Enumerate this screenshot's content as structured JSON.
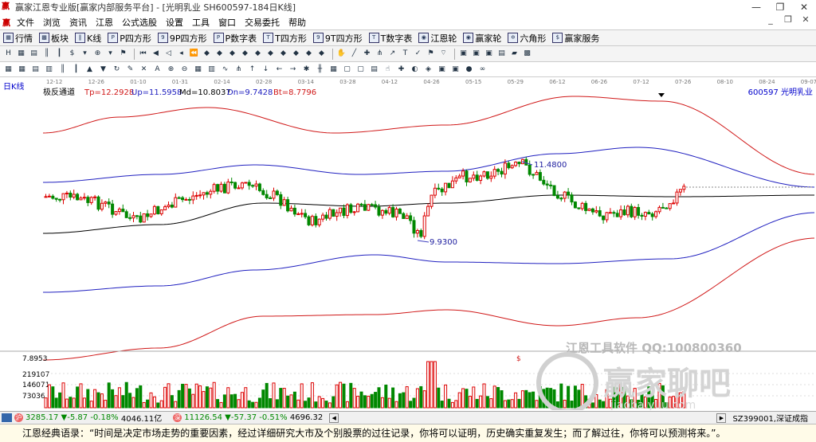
{
  "window": {
    "title": "赢家江恩专业版[赢家内部服务平台] - [光明乳业  SH600597-184日K线]",
    "minimize": "—",
    "restore": "❐",
    "close": "✕"
  },
  "menu": {
    "items": [
      "文件",
      "浏览",
      "资讯",
      "江恩",
      "公式选股",
      "设置",
      "工具",
      "窗口",
      "交易委托",
      "帮助"
    ],
    "mdi_minimize": "_",
    "mdi_restore": "❐",
    "mdi_close": "✕"
  },
  "toolbar": {
    "items": [
      {
        "icon": "table-icon",
        "glyph": "▦",
        "label": "行情"
      },
      {
        "icon": "sector-icon",
        "glyph": "▩",
        "label": "板块"
      },
      {
        "icon": "candle-icon",
        "glyph": "‖",
        "label": "K线"
      },
      {
        "icon": "p-square-icon",
        "glyph": "P",
        "label": "P四方形"
      },
      {
        "icon": "9p-square-icon",
        "glyph": "9",
        "label": "9P四方形"
      },
      {
        "icon": "p-table-icon",
        "glyph": "P",
        "label": "P数字表"
      },
      {
        "icon": "t-square-icon",
        "glyph": "T",
        "label": "T四方形"
      },
      {
        "icon": "9t-square-icon",
        "glyph": "9",
        "label": "9T四方形"
      },
      {
        "icon": "t-table-icon",
        "glyph": "T",
        "label": "T数字表"
      },
      {
        "icon": "gann-wheel-icon",
        "glyph": "◉",
        "label": "江恩轮"
      },
      {
        "icon": "winner-wheel-icon",
        "glyph": "◉",
        "label": "赢家轮"
      },
      {
        "icon": "hexagon-icon",
        "glyph": "✡",
        "label": "六角形"
      },
      {
        "icon": "service-icon",
        "glyph": "$",
        "label": "赢家服务"
      }
    ]
  },
  "chart_header": {
    "period": "日K线",
    "indicator": "极反通道",
    "tp": "Tp=12.2928",
    "up": "Up=11.5958",
    "md": "Md=10.8037",
    "dn": "Dn=9.7428",
    "bt": "Bt=8.7796",
    "stock": "600597  光明乳业"
  },
  "date_labels": [
    "12-12",
    "12-26",
    "01-10",
    "01-31",
    "02-14",
    "02-28",
    "03-14",
    "03-28",
    "04-12",
    "04-26",
    "05-15",
    "05-29",
    "06-12",
    "06-26",
    "07-12",
    "07-26",
    "08-10",
    "08-24",
    "09-07"
  ],
  "annotations": {
    "high": "11.4800",
    "low": "9.9300",
    "dollar": "$"
  },
  "volume_labels": {
    "top": "7.8953",
    "v1": "219107",
    "v2": "146071",
    "v3": "73036"
  },
  "watermark": {
    "text1": "江恩工具软件  QQ:100800360",
    "text2": "赢家聊吧",
    "text3": "jiaoba.yuu.com"
  },
  "status": {
    "sh_index": "3285.17",
    "sh_change": "▼-5.87",
    "sh_pct": "-0.18%",
    "sh_amount": "4046.11亿",
    "sz_index": "11126.54",
    "sz_change": "▼-57.37",
    "sz_pct": "-0.51%",
    "sz_amount": "4696.32",
    "right_code": "SZ399001,深证成指"
  },
  "quote": "江恩经典语录：“时间是决定市场走势的重要因素，经过详细研究大市及个别股票的过往记录，你将可以证明，历史确实重复发生；而了解过往，你将可以预测将来。”。",
  "colors": {
    "up": "#dd0000",
    "down": "#008800",
    "band_outer": "#d01818",
    "band_inner": "#2020c0",
    "mid": "#000000"
  }
}
